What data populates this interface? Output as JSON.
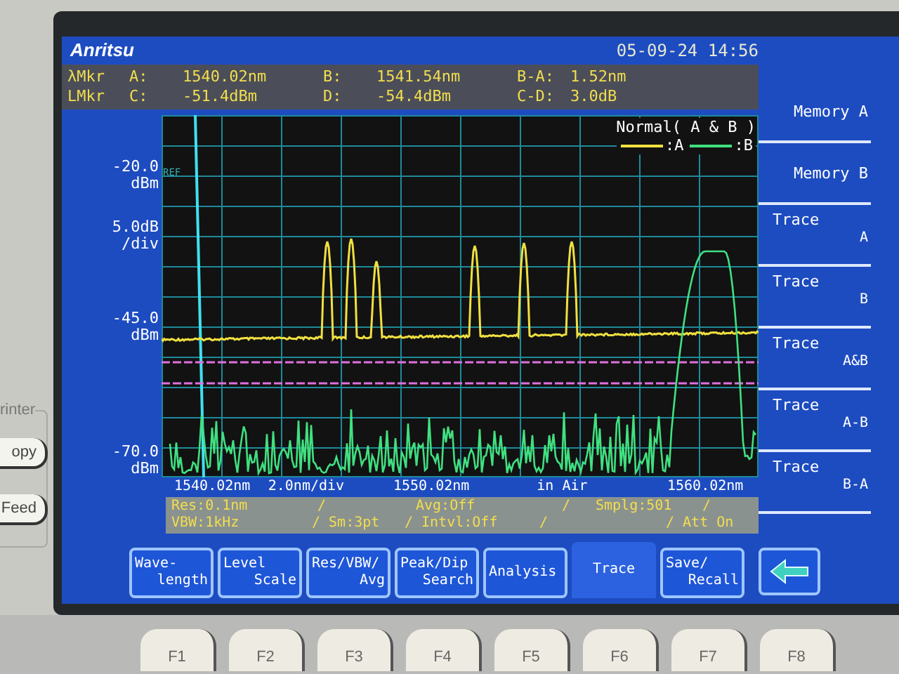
{
  "header": {
    "logo": "Anritsu",
    "datetime": "05-09-24 14:56"
  },
  "markers": [
    {
      "label": "λMkr",
      "cells": [
        {
          "name": "A:",
          "value": "1540.02nm"
        },
        {
          "name": "B:",
          "value": "1541.54nm"
        },
        {
          "name": "B-A:",
          "value": "1.52nm"
        }
      ]
    },
    {
      "label": "LMkr",
      "cells": [
        {
          "name": "C:",
          "value": "-51.4dBm"
        },
        {
          "name": "D:",
          "value": "-54.4dBm"
        },
        {
          "name": "C-D:",
          "value": "3.0dB"
        }
      ]
    }
  ],
  "plot": {
    "ref_label": "REF",
    "y_labels": [
      {
        "value": "-20.0",
        "unit": "dBm"
      },
      {
        "value": "5.0dB",
        "unit": "/div"
      },
      {
        "value": "-45.0",
        "unit": "dBm"
      },
      {
        "value": "-70.0",
        "unit": "dBm"
      }
    ],
    "legend": {
      "title": "Normal( A & B )",
      "traces": [
        {
          "label": ":A",
          "color": "#f0e040"
        },
        {
          "label": ":B",
          "color": "#40e080"
        }
      ]
    },
    "x_labels": [
      "1540.02nm",
      "2.0nm/div",
      "1550.02nm",
      "in Air",
      "1560.02nm"
    ]
  },
  "status": [
    [
      "Res:0.1nm",
      "/",
      "Avg:Off",
      "/",
      "Smplg:501",
      "/"
    ],
    [
      "VBW:1kHz",
      "/ Sm:3pt",
      "/ Intvl:Off",
      "/",
      "/ Att On"
    ]
  ],
  "softkeys": [
    {
      "label": "Memory A"
    },
    {
      "label": "Memory B"
    },
    {
      "label": "Trace",
      "sub": "A"
    },
    {
      "label": "Trace",
      "sub": "B"
    },
    {
      "label": "Trace",
      "sub": "A&B"
    },
    {
      "label": "Trace",
      "sub": "A-B"
    },
    {
      "label": "Trace",
      "sub": "B-A"
    }
  ],
  "tabs": [
    {
      "lines": [
        "Wave-",
        "length"
      ],
      "selected": false
    },
    {
      "lines": [
        "Level",
        "Scale"
      ],
      "selected": false
    },
    {
      "lines": [
        "Res/VBW/",
        "Avg"
      ],
      "selected": false
    },
    {
      "lines": [
        "Peak/Dip",
        "Search"
      ],
      "selected": false
    },
    {
      "lines": [
        "Analysis"
      ],
      "selected": false
    },
    {
      "lines": [
        "Trace"
      ],
      "selected": true
    },
    {
      "lines": [
        "Save/",
        "Recall"
      ],
      "selected": false
    }
  ],
  "printer": {
    "label": "rinter",
    "buttons": [
      "opy",
      "Feed"
    ]
  },
  "function_keys": [
    "F1",
    "F2",
    "F3",
    "F4",
    "F5",
    "F6",
    "F7",
    "F8"
  ]
}
